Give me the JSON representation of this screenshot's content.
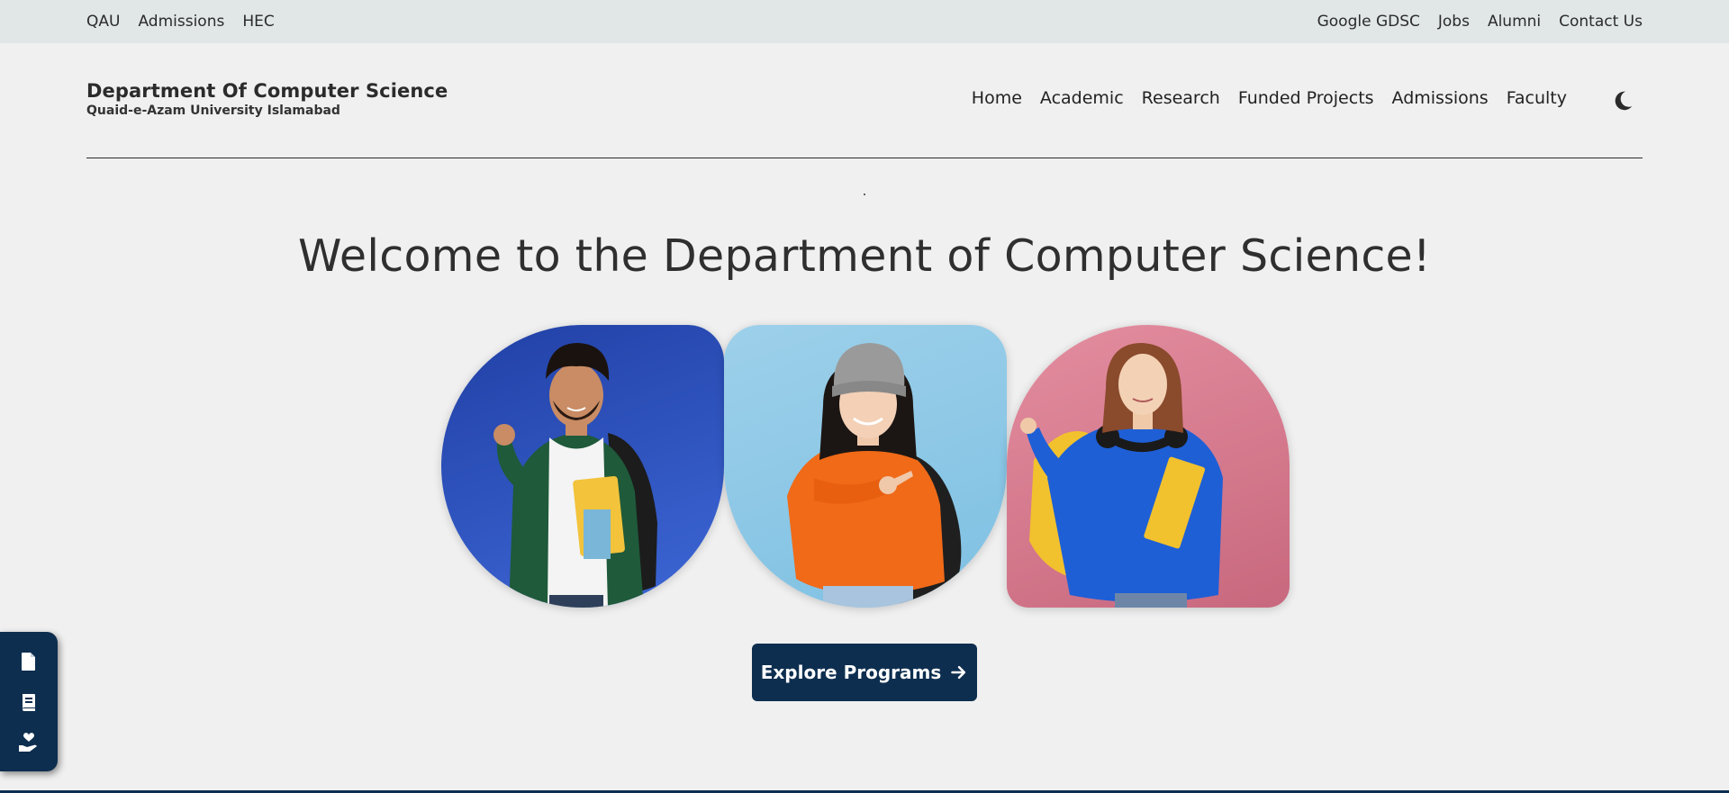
{
  "topbar": {
    "left_links": [
      "QAU",
      "Admissions",
      "HEC"
    ],
    "right_links": [
      "Google GDSC",
      "Jobs",
      "Alumni",
      "Contact Us"
    ]
  },
  "brand": {
    "title": "Department Of Computer Science",
    "subtitle": "Quaid-e-Azam University Islamabad"
  },
  "nav": {
    "items": [
      "Home",
      "Academic",
      "Research",
      "Funded Projects",
      "Admissions",
      "Faculty"
    ],
    "theme_toggle_icon": "moon-icon"
  },
  "hero": {
    "title": "Welcome to the Department of Computer Science!",
    "photos": [
      {
        "name": "student-photo-1",
        "background": "#2a4fbf"
      },
      {
        "name": "student-photo-2",
        "background": "#9dd0ea"
      },
      {
        "name": "student-photo-3",
        "background": "#d97a8e"
      }
    ],
    "cta_label": "Explore Programs",
    "cta_icon": "arrow-right-icon"
  },
  "dock": {
    "icons": [
      "document-icon",
      "book-icon",
      "hand-heart-icon"
    ]
  },
  "colors": {
    "accent": "#0d2e4f",
    "topbar_bg": "#e1e6e6",
    "page_bg": "#f0f0f0"
  }
}
